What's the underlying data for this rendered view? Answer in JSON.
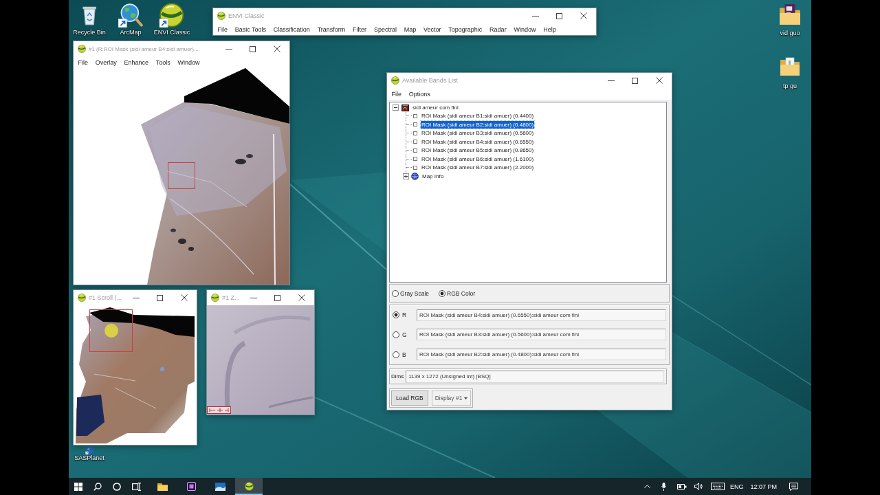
{
  "desktop_icons": [
    {
      "label": "Recycle Bin",
      "kind": "recycle-bin",
      "shortcut": false
    },
    {
      "label": "ArcMap",
      "kind": "arcmap",
      "shortcut": true
    },
    {
      "label": "ENVI Classic",
      "kind": "envi",
      "shortcut": true
    },
    {
      "label": "vid guo",
      "kind": "folder-document",
      "shortcut": false
    },
    {
      "label": "tp gu",
      "kind": "folder",
      "shortcut": false
    },
    {
      "label": "SASPlanet",
      "kind": "globe",
      "shortcut": true
    }
  ],
  "envi_window": {
    "title": "ENVI Classic",
    "menu": [
      "File",
      "Basic Tools",
      "Classification",
      "Transform",
      "Filter",
      "Spectral",
      "Map",
      "Vector",
      "Topographic",
      "Radar",
      "Window",
      "Help"
    ]
  },
  "image_window": {
    "title": "#1 (R:ROI Mask (sidi ameur B4:sidi amuer),...",
    "menu": [
      "File",
      "Overlay",
      "Enhance",
      "Tools",
      "Window"
    ]
  },
  "scroll_window": {
    "title": "#1 Scroll (..."
  },
  "zoom_window": {
    "title": "#1 Z..."
  },
  "bands_window": {
    "title": "Available Bands List",
    "menu": [
      "File",
      "Options"
    ],
    "tree": {
      "label": "sidi ameur com fini",
      "expanded": true,
      "selected": false,
      "children": [
        {
          "label": "ROI Mask (sidi ameur B1:sidi amuer) (0.4400)",
          "kind": "band",
          "selected": false
        },
        {
          "label": "ROI Mask (sidi ameur B2:sidi amuer) (0.4800)",
          "kind": "band",
          "selected": true
        },
        {
          "label": "ROI Mask (sidi ameur B3:sidi amuer) (0.5600)",
          "kind": "band",
          "selected": false
        },
        {
          "label": "ROI Mask (sidi ameur B4:sidi amuer) (0.6550)",
          "kind": "band",
          "selected": false
        },
        {
          "label": "ROI Mask (sidi ameur B5:sidi amuer) (0.8650)",
          "kind": "band",
          "selected": false
        },
        {
          "label": "ROI Mask (sidi ameur B6:sidi amuer) (1.6100)",
          "kind": "band",
          "selected": false
        },
        {
          "label": "ROI Mask (sidi ameur B7:sidi amuer) (2.2000)",
          "kind": "band",
          "selected": false
        },
        {
          "label": "Map Info",
          "kind": "map-info",
          "expanded": false,
          "selected": false
        }
      ]
    },
    "modes": [
      {
        "label": "Gray Scale",
        "selected": false
      },
      {
        "label": "RGB Color",
        "selected": true
      }
    ],
    "channels": [
      {
        "label": "R",
        "selected": true,
        "value": "ROI Mask (sidi ameur B4:sidi amuer) (0.6550):sidi ameur com fini"
      },
      {
        "label": "G",
        "selected": false,
        "value": "ROI Mask (sidi ameur B3:sidi amuer) (0.5600):sidi ameur com fini"
      },
      {
        "label": "B",
        "selected": false,
        "value": "ROI Mask (sidi ameur B2:sidi amuer) (0.4800):sidi ameur com fini"
      }
    ],
    "dims_label": "Dims",
    "dims": "1139 x 1272 (Unsigned Int) [BSQ]",
    "load_button": "Load RGB",
    "display_menu": "Display #1"
  },
  "taskbar": {
    "apps": [
      {
        "kind": "folder",
        "active": false
      },
      {
        "kind": "tile",
        "active": false
      },
      {
        "kind": "picture",
        "active": false
      },
      {
        "kind": "ball",
        "active": true
      }
    ],
    "language": "ENG",
    "clock": "12:07 PM"
  }
}
